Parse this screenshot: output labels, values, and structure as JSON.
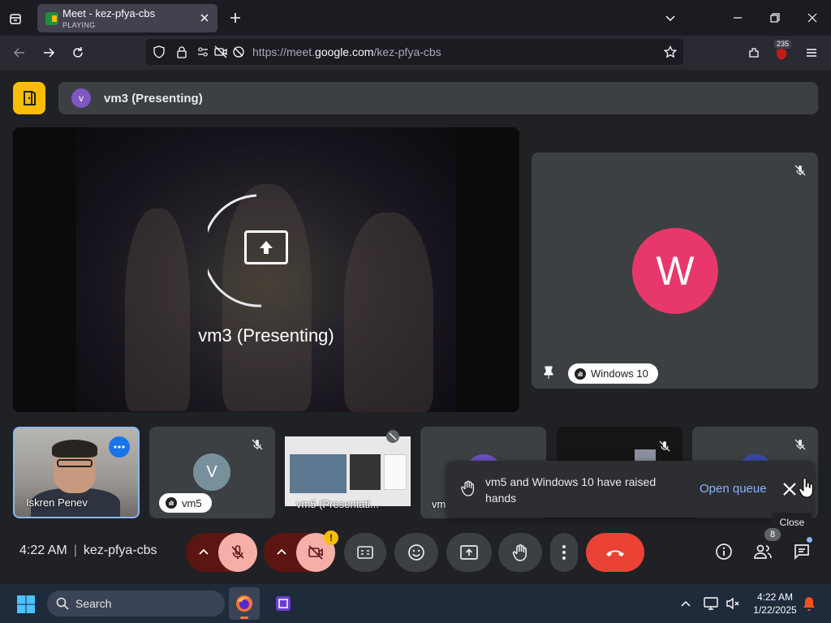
{
  "browser": {
    "tab_title": "Meet - kez-pfya-cbs",
    "tab_status": "PLAYING",
    "url_prefix": "https://meet.",
    "url_domain": "google.com",
    "url_path": "/kez-pfya-cbs",
    "extension_badge": "235"
  },
  "meeting": {
    "presenter_avatar": "v",
    "presenter_label": "vm3 (Presenting)",
    "main_caption": "vm3 (Presenting)",
    "pinned_tile": {
      "avatar_letter": "W",
      "name": "Windows 10",
      "color": "#e8376a"
    },
    "tiles": [
      {
        "name": "Iskren Penev"
      },
      {
        "avatar_letter": "V",
        "name": "vm5"
      },
      {
        "name": "vm5 (Presentati..."
      },
      {
        "name": "vm"
      },
      {
        "name": ""
      },
      {
        "name": ""
      }
    ]
  },
  "toast": {
    "message": "vm5 and Windows 10 have raised hands",
    "action": "Open queue",
    "close_tooltip": "Close"
  },
  "controls": {
    "time": "4:22 AM",
    "separator": "|",
    "meeting_code": "kez-pfya-cbs",
    "camera_warning": "!",
    "participant_count": "8"
  },
  "taskbar": {
    "search_label": "Search",
    "time": "4:22 AM",
    "date": "1/22/2025"
  },
  "colors": {
    "accent": "#8ab4f8",
    "end_call": "#ea4335",
    "hand_raise": "#fbbc04"
  }
}
